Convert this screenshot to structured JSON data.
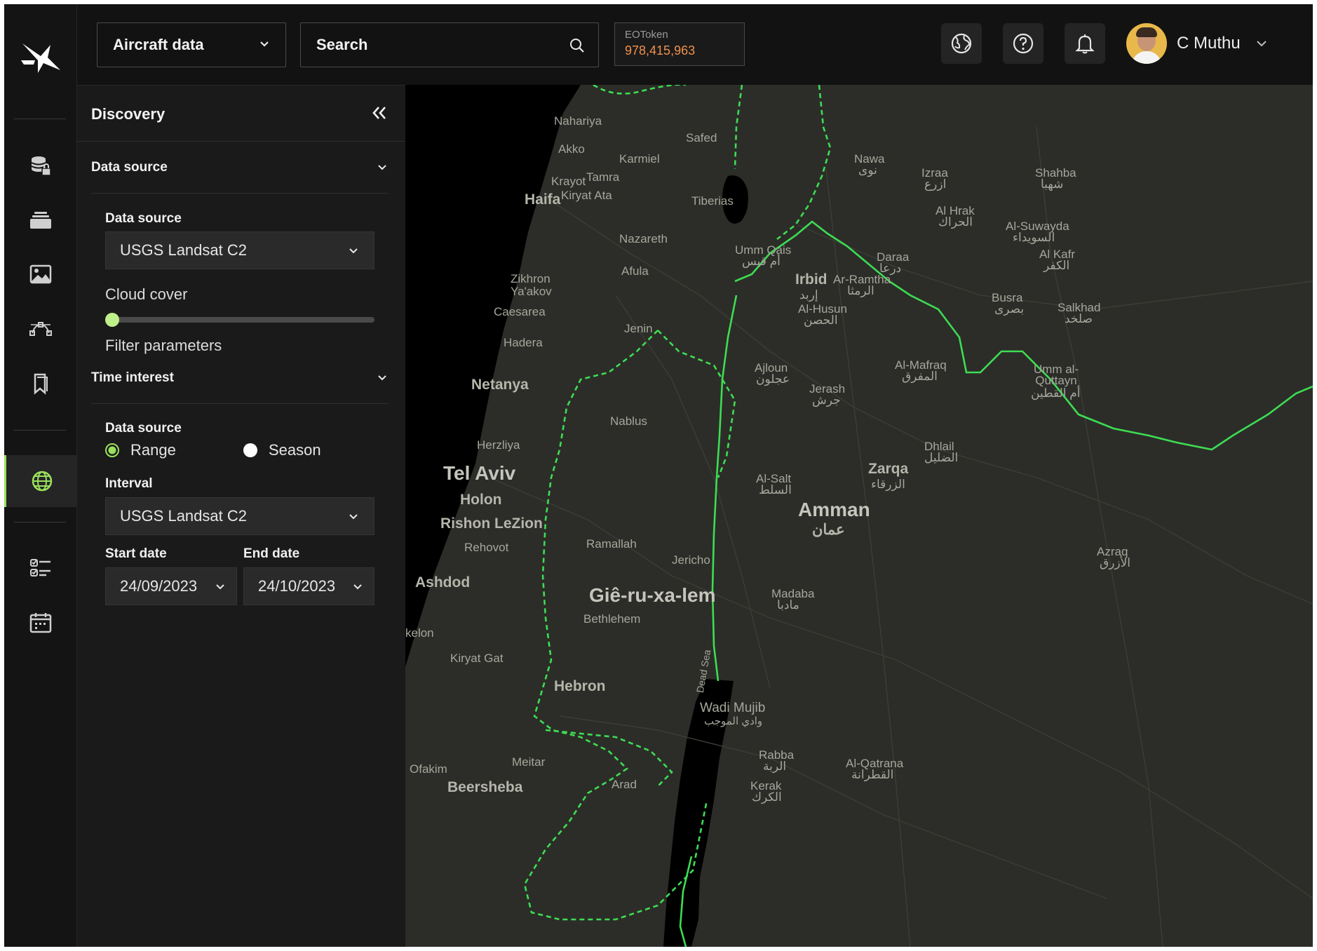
{
  "topbar": {
    "data_type_select": "Aircraft data",
    "search_placeholder": "Search",
    "token": {
      "label": "EOToken",
      "value": "978,415,963"
    },
    "user_name": "C Muthu"
  },
  "rail": {
    "icons": [
      "logo-icon",
      "database-lock-icon",
      "layers-icon",
      "image-icon",
      "vector-path-icon",
      "bookmark-icon",
      "globe-icon",
      "checklist-icon",
      "calendar-icon"
    ],
    "active": "globe-icon"
  },
  "panel": {
    "title": "Discovery",
    "sections": {
      "data_source": {
        "title": "Data source",
        "field_label": "Data source",
        "selected": "USGS Landsat C2",
        "cloud_cover_label": "Cloud cover",
        "cloud_cover_value": 0,
        "filter_label": "Filter parameters"
      },
      "time_interest": {
        "title": "Time interest",
        "field_label": "Data source",
        "radio_range": "Range",
        "radio_season": "Season",
        "selected_radio": "Range",
        "interval_label": "Interval",
        "interval_selected": "USGS Landsat C2",
        "start_label": "Start date",
        "start_value": "24/09/2023",
        "end_label": "End date",
        "end_value": "24/10/2023"
      }
    }
  },
  "map": {
    "labels": {
      "nahariya": "Nahariya",
      "akko": "Akko",
      "safed": "Safed",
      "karmiel": "Karmiel",
      "krayot": "Krayot",
      "tamra": "Tamra",
      "haifa": "Haifa",
      "kiryat_ata": "Kiryat Ata",
      "tiberias": "Tiberias",
      "nazareth": "Nazareth",
      "afula": "Afula",
      "zikhron": "Zikhron Ya'akov",
      "caesarea": "Caesarea",
      "jenin": "Jenin",
      "hadera": "Hadera",
      "netanya": "Netanya",
      "nablus": "Nablus",
      "herzliya": "Herzliya",
      "tel_aviv": "Tel Aviv",
      "holon": "Holon",
      "rishon": "Rishon LeZion",
      "rehovot": "Rehovot",
      "ramallah": "Ramallah",
      "jericho": "Jericho",
      "ashdod": "Ashdod",
      "jerusalem": "Giê-ru-xa-lem",
      "bethlehem": "Bethlehem",
      "ashkelon": "kelon",
      "kiryat_gat": "Kiryat Gat",
      "hebron": "Hebron",
      "ofakim": "Ofakim",
      "meitar": "Meitar",
      "beersheba": "Beersheba",
      "arad": "Arad",
      "dead_sea": "Dead Sea",
      "wadi_mujib": "Wadi Mujib",
      "wadi_mujib_ar": "وادي الموجب",
      "nawa": "Nawa",
      "nawa_ar": "نوى",
      "izraa": "Izraa",
      "izraa_ar": "ازرع",
      "shahba": "Shahba",
      "shahba_ar": "شهبا",
      "umm_qais": "Umm Qais",
      "umm_qais_ar": "أم قيس",
      "al_hrak": "Al Hrak",
      "al_hrak_ar": "الحراك",
      "al_suwayda": "Al-Suwayda",
      "al_suwayda_ar": "السويداء",
      "daraa": "Daraa",
      "daraa_ar": "درعا",
      "al_kafr": "Al Kafr",
      "al_kafr_ar": "الكفر",
      "irbid": "Irbid",
      "irbid_ar": "إربد",
      "ar_ramtha": "Ar-Ramtha",
      "ar_ramtha_ar": "الرمثا",
      "al_husun": "Al-Husun",
      "al_husun_ar": "الحصن",
      "busra": "Busra",
      "busra_ar": "بصرى",
      "salkhad": "Salkhad",
      "salkhad_ar": "صلخد",
      "ajloun": "Ajloun",
      "ajloun_ar": "عجلون",
      "al_mafraq": "Al-Mafraq",
      "al_mafraq_ar": "المفرق",
      "umm_al_quttayn": "Umm al-Quttayn",
      "umm_al_quttayn_ar": "أم القطين",
      "jerash": "Jerash",
      "jerash_ar": "جرش",
      "dhlail": "Dhlail",
      "dhlail_ar": "الضليل",
      "zarqa": "Zarqa",
      "zarqa_ar": "الزرقاء",
      "al_salt": "Al-Salt",
      "al_salt_ar": "السلط",
      "amman": "Amman",
      "amman_ar": "عمان",
      "azraq": "Azraq",
      "azraq_ar": "الأزرق",
      "madaba": "Madaba",
      "madaba_ar": "مادبا",
      "rabba": "Rabba",
      "rabba_ar": "الربة",
      "al_qatrana": "Al-Qatrana",
      "al_qatrana_ar": "القطرانة",
      "kerak": "Kerak",
      "kerak_ar": "الكرك"
    },
    "colors": {
      "border": "#3ddc54",
      "land": "#2c2d28",
      "sea": "#000000"
    }
  }
}
